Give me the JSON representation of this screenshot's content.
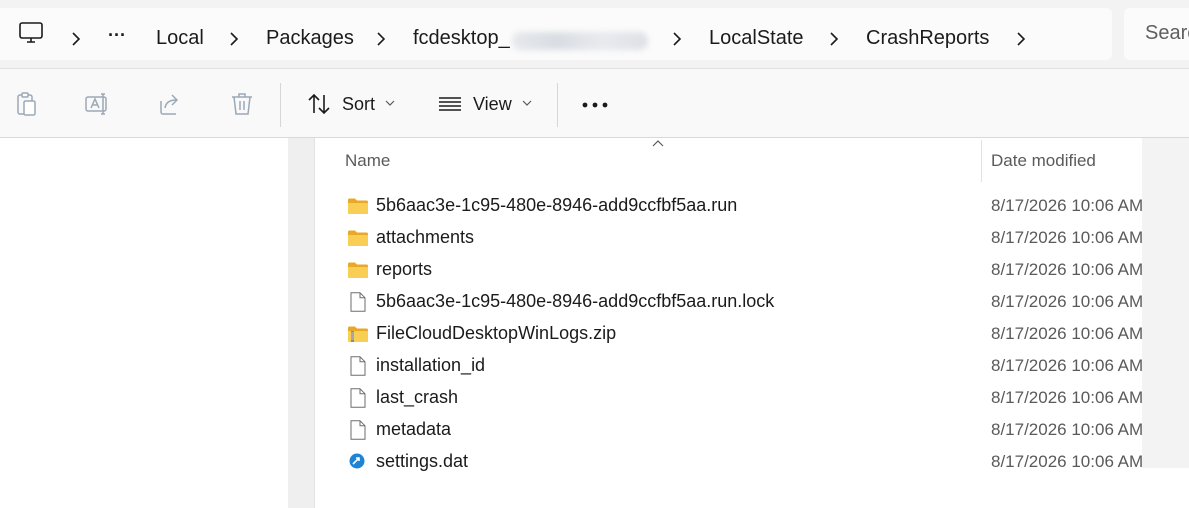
{
  "address_bar": {
    "breadcrumbs": [
      "Local",
      "Packages",
      "fcdesktop_",
      "LocalState",
      "CrashReports"
    ],
    "overflow_label": "···",
    "search_placeholder": "Search"
  },
  "toolbar": {
    "sort_label": "Sort",
    "view_label": "View",
    "more_label": "···"
  },
  "list": {
    "columns": {
      "name": "Name",
      "date": "Date modified"
    },
    "rows": [
      {
        "name": "5b6aac3e-1c95-480e-8946-add9ccfbf5aa.run",
        "date": "8/17/2026 10:06 AM",
        "icon": "folder-icon"
      },
      {
        "name": "attachments",
        "date": "8/17/2026 10:06 AM",
        "icon": "folder-icon"
      },
      {
        "name": "reports",
        "date": "8/17/2026 10:06 AM",
        "icon": "folder-icon"
      },
      {
        "name": "5b6aac3e-1c95-480e-8946-add9ccfbf5aa.run.lock",
        "date": "8/17/2026 10:06 AM",
        "icon": "file-icon"
      },
      {
        "name": "FileCloudDesktopWinLogs.zip",
        "date": "8/17/2026 10:06 AM",
        "icon": "zip-folder-icon"
      },
      {
        "name": "installation_id",
        "date": "8/17/2026 10:06 AM",
        "icon": "file-icon"
      },
      {
        "name": "last_crash",
        "date": "8/17/2026 10:06 AM",
        "icon": "file-icon"
      },
      {
        "name": "metadata",
        "date": "8/17/2026 10:06 AM",
        "icon": "file-icon"
      },
      {
        "name": "settings.dat",
        "date": "8/17/2026 10:06 AM",
        "icon": "settings-file-icon"
      }
    ]
  },
  "colors": {
    "folder_yellow": "#f5c542",
    "settings_blue": "#1d84d6",
    "toolbar_bg": "#f9f9f9",
    "addressbar_bg": "#f3f3f3"
  }
}
